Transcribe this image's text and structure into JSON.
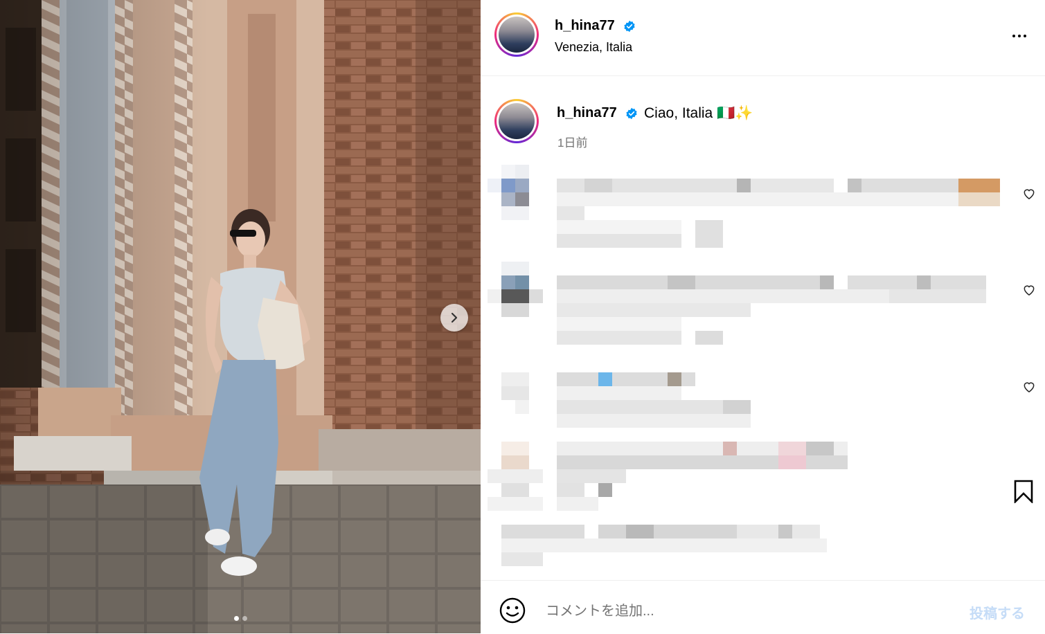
{
  "post": {
    "username": "h_hina77",
    "location": "Venezia, Italia",
    "caption": "Ciao, Italia 🇮🇹✨",
    "time_ago": "1日前",
    "verified_icon": "verified-badge-icon",
    "carousel_count": 2,
    "carousel_active_index": 0
  },
  "composer": {
    "placeholder": "コメントを追加...",
    "post_label": "投稿する"
  },
  "colors": {
    "verified_blue": "#0095f6",
    "post_disabled": "#c5dcf7",
    "secondary_text": "#737373",
    "divider": "#efefef"
  }
}
